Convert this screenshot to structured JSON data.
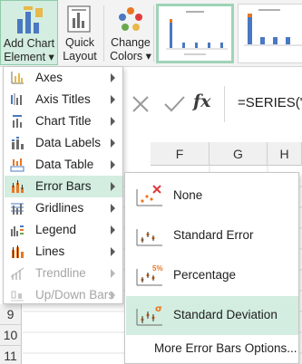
{
  "ribbon": {
    "add_chart_element": {
      "line1": "Add Chart",
      "line2": "Element ▾"
    },
    "quick_layout": {
      "line1": "Quick",
      "line2": "Layout ▾"
    },
    "change_colors": {
      "line1": "Change",
      "line2": "Colors ▾"
    }
  },
  "formula_bar": {
    "fx": "fx",
    "formula": "=SERIES(\"m"
  },
  "columns": [
    "F",
    "G",
    "H"
  ],
  "rows": [
    "9",
    "10",
    "11"
  ],
  "menu": {
    "items": [
      {
        "label": "Axes",
        "icon": "axes-icon",
        "enabled": true
      },
      {
        "label": "Axis Titles",
        "icon": "axis-titles-icon",
        "enabled": true
      },
      {
        "label": "Chart Title",
        "icon": "chart-title-icon",
        "enabled": true
      },
      {
        "label": "Data Labels",
        "icon": "data-labels-icon",
        "enabled": true
      },
      {
        "label": "Data Table",
        "icon": "data-table-icon",
        "enabled": true
      },
      {
        "label": "Error Bars",
        "icon": "error-bars-icon",
        "enabled": true,
        "highlighted": true
      },
      {
        "label": "Gridlines",
        "icon": "gridlines-icon",
        "enabled": true
      },
      {
        "label": "Legend",
        "icon": "legend-icon",
        "enabled": true
      },
      {
        "label": "Lines",
        "icon": "lines-icon",
        "enabled": true
      },
      {
        "label": "Trendline",
        "icon": "trendline-icon",
        "enabled": false
      },
      {
        "label": "Up/Down Bars",
        "icon": "up-down-bars-icon",
        "enabled": false
      }
    ]
  },
  "submenu": {
    "items": [
      {
        "label": "None",
        "icon": "error-bars-none-icon"
      },
      {
        "label": "Standard Error",
        "icon": "standard-error-icon"
      },
      {
        "label": "Percentage",
        "icon": "percentage-error-icon",
        "icon_text": "5%"
      },
      {
        "label": "Standard Deviation",
        "icon": "standard-deviation-icon",
        "icon_text": "σ",
        "highlighted": true
      }
    ],
    "more": "More Error Bars Options..."
  },
  "colors": {
    "accent_green": "#d3ede0",
    "accent_border": "#8fcaa9",
    "icon_red": "#e03b3b",
    "icon_orange": "#e87722",
    "icon_blue": "#4a78c2"
  }
}
